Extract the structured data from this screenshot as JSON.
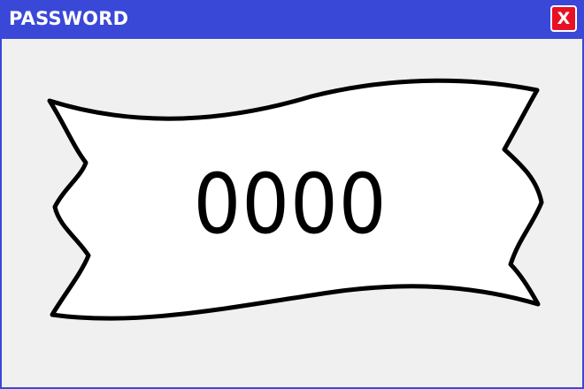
{
  "window": {
    "title": "PASSWORD",
    "close_label": "X",
    "accent_color": "#3a48d8",
    "close_color": "#e81123"
  },
  "banner": {
    "password": "0000"
  }
}
